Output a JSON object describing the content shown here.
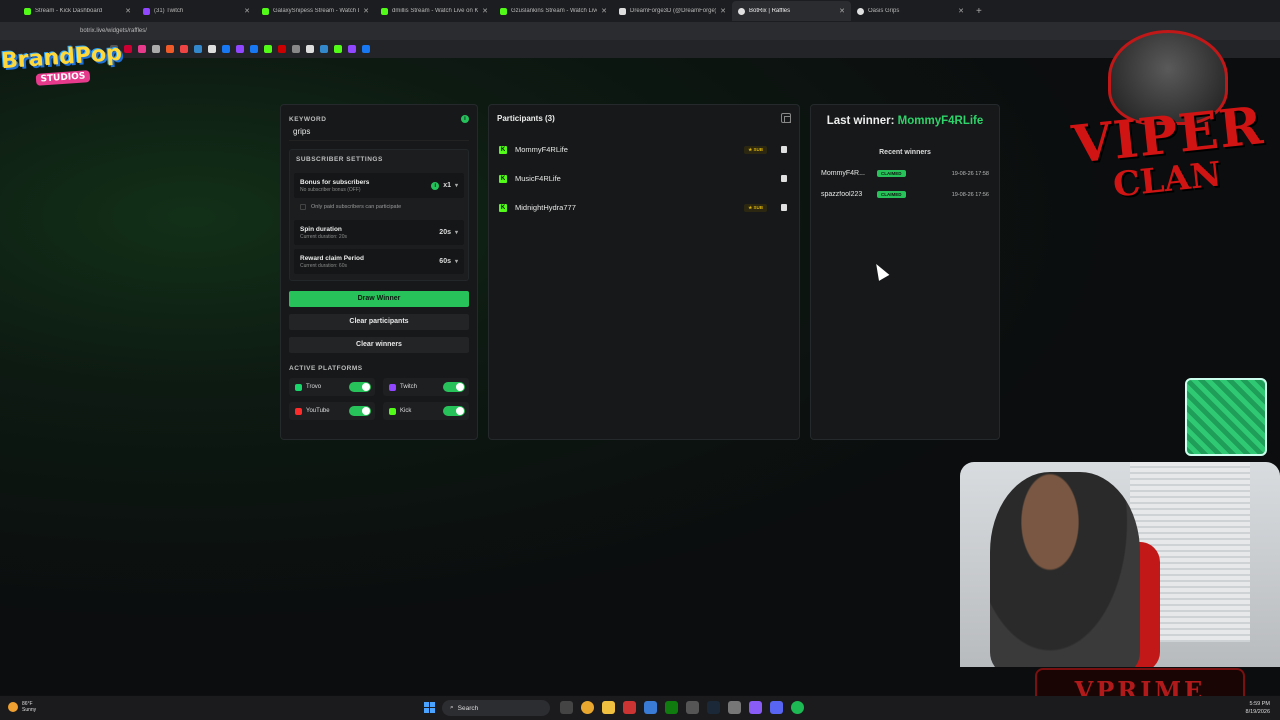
{
  "browser": {
    "tabs": [
      {
        "label": "Stream - Kick Dashboard",
        "icon": "kick-icon",
        "active": false
      },
      {
        "label": "(31) Twitch",
        "icon": "twitch-icon",
        "active": false
      },
      {
        "label": "GalaxySnipess Stream - Watch Live",
        "icon": "kick-icon",
        "active": false
      },
      {
        "label": "dmillis Stream - Watch Live on Kick",
        "icon": "kick-icon",
        "active": false
      },
      {
        "label": "Gzuslankins Stream - Watch Live",
        "icon": "kick-icon",
        "active": false
      },
      {
        "label": "DreamForge3D (@DreamForge)",
        "icon": "x-icon",
        "active": false
      },
      {
        "label": "BotRix | Raffles",
        "icon": "botrix-icon",
        "active": true
      },
      {
        "label": "Oasis Grips",
        "icon": "generic-icon",
        "active": false
      }
    ],
    "url": "botrix.live/widgets/raffles/"
  },
  "overlay": {
    "brand_line1": "BrandPop",
    "brand_line2": "STUDIOS",
    "clan_line1": "VIPER",
    "clan_line2": "CLAN",
    "vprime": "VPRIME"
  },
  "raffle": {
    "keyword_label": "KEYWORD",
    "keyword_value": "grips",
    "subscriber_settings_label": "SUBSCRIBER SETTINGS",
    "bonus_title": "Bonus for subscribers",
    "bonus_sub": "No subscriber bonus (OFF)",
    "bonus_value": "x1",
    "only_paid_label": "Only paid subscribers can participate",
    "spin_title": "Spin duration",
    "spin_sub": "Current duration: 20s",
    "spin_value": "20s",
    "reward_title": "Reward claim Period",
    "reward_sub": "Current duration: 60s",
    "reward_value": "60s",
    "draw_winner": "Draw Winner",
    "clear_participants": "Clear participants",
    "clear_winners": "Clear winners",
    "active_platforms_label": "ACTIVE PLATFORMS",
    "platforms": [
      {
        "name": "Trovo",
        "color": "#19d66b",
        "enabled": true
      },
      {
        "name": "Twitch",
        "color": "#9146ff",
        "enabled": true
      },
      {
        "name": "YouTube",
        "color": "#ff2a2a",
        "enabled": true
      },
      {
        "name": "Kick",
        "color": "#53fc18",
        "enabled": true
      }
    ]
  },
  "participants": {
    "title": "Participants (3)",
    "items": [
      {
        "name": "MommyF4RLife",
        "badge": "SUB"
      },
      {
        "name": "MusicF4RLife",
        "badge": ""
      },
      {
        "name": "MidnightHydra777",
        "badge": "SUB"
      }
    ]
  },
  "winners": {
    "last_winner_label": "Last winner:",
    "last_winner_name": "MommyF4RLife",
    "recent_title": "Recent winners",
    "items": [
      {
        "name": "MommyF4R...",
        "status": "CLAIMED",
        "time": "19-08-26 17:58"
      },
      {
        "name": "spazzfool223",
        "status": "CLAIMED",
        "time": "19-08-26 17:56"
      }
    ]
  },
  "taskbar": {
    "weather_temp": "86°F",
    "weather_desc": "Sunny",
    "search_placeholder": "Search",
    "time": "5:59 PM",
    "date": "8/19/2026"
  },
  "colors": {
    "accent_green": "#27c25a",
    "kick_green": "#53fc18",
    "panel_bg": "#161819"
  }
}
